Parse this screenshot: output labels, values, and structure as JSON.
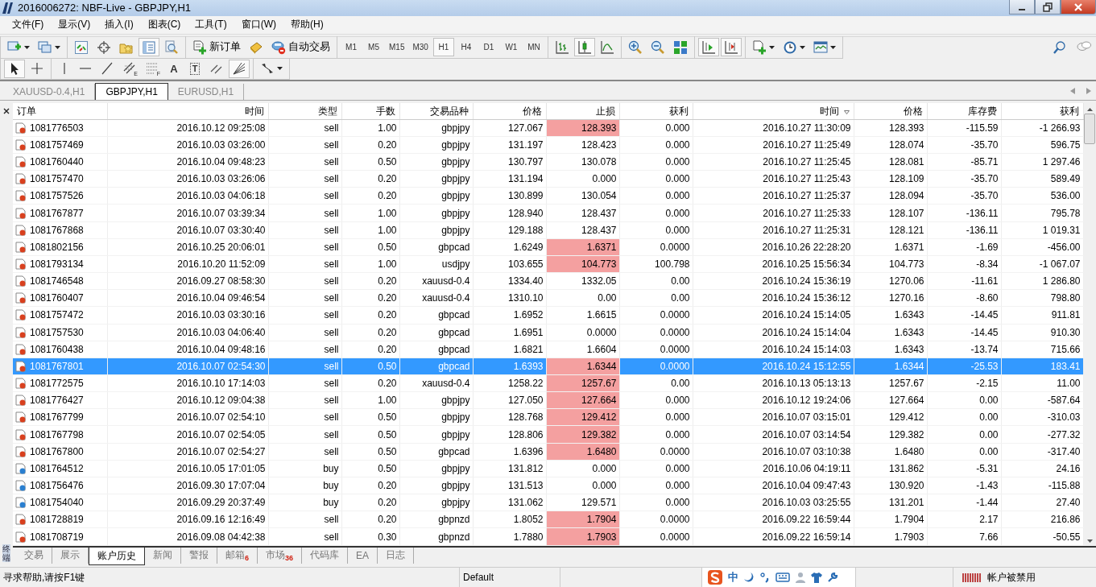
{
  "window": {
    "title": "2016006272: NBF-Live - GBPJPY,H1"
  },
  "menu": [
    {
      "label": "文件(F)"
    },
    {
      "label": "显示(V)"
    },
    {
      "label": "插入(I)"
    },
    {
      "label": "图表(C)"
    },
    {
      "label": "工具(T)"
    },
    {
      "label": "窗口(W)"
    },
    {
      "label": "帮助(H)"
    }
  ],
  "toolbar_main": {
    "groups": [
      {
        "items": [
          {
            "kind": "new-chart",
            "pressed": false,
            "dropdown": true
          },
          {
            "kind": "profiles",
            "pressed": false,
            "dropdown": true
          }
        ]
      },
      {
        "items": [
          {
            "kind": "market-watch",
            "pressed": false
          },
          {
            "kind": "data-window",
            "pressed": false
          },
          {
            "kind": "navigator",
            "pressed": false
          },
          {
            "kind": "terminal",
            "pressed": true
          },
          {
            "kind": "tester",
            "pressed": false
          }
        ]
      },
      {
        "items": [
          {
            "kind": "new-order",
            "label": "新订单",
            "pressed": false
          },
          {
            "kind": "editor",
            "pressed": false
          },
          {
            "kind": "auto-trading",
            "label": "自动交易",
            "pressed": false
          }
        ]
      },
      {
        "items": [
          {
            "kind": "timeframe",
            "label": "M1",
            "selected": false
          },
          {
            "kind": "timeframe",
            "label": "M5",
            "selected": false
          },
          {
            "kind": "timeframe",
            "label": "M15",
            "selected": false
          },
          {
            "kind": "timeframe",
            "label": "M30",
            "selected": false
          },
          {
            "kind": "timeframe",
            "label": "H1",
            "selected": true
          },
          {
            "kind": "timeframe",
            "label": "H4",
            "selected": false
          },
          {
            "kind": "timeframe",
            "label": "D1",
            "selected": false
          },
          {
            "kind": "timeframe",
            "label": "W1",
            "selected": false
          },
          {
            "kind": "timeframe",
            "label": "MN",
            "selected": false
          }
        ]
      },
      {
        "items": [
          {
            "kind": "bar-chart",
            "pressed": false
          },
          {
            "kind": "candle-chart",
            "pressed": true
          },
          {
            "kind": "line-chart",
            "pressed": false
          }
        ]
      },
      {
        "items": [
          {
            "kind": "zoom-in",
            "pressed": false
          },
          {
            "kind": "zoom-out",
            "pressed": false
          },
          {
            "kind": "tile",
            "pressed": false
          }
        ]
      },
      {
        "items": [
          {
            "kind": "autoscroll",
            "pressed": true
          },
          {
            "kind": "chart-shift",
            "pressed": true
          }
        ]
      },
      {
        "items": [
          {
            "kind": "indicators",
            "pressed": false,
            "dropdown": true
          },
          {
            "kind": "periods",
            "pressed": false,
            "dropdown": true
          },
          {
            "kind": "templates",
            "pressed": false,
            "dropdown": true
          }
        ]
      }
    ]
  },
  "toolbar_right": [
    {
      "kind": "search"
    },
    {
      "kind": "chat"
    }
  ],
  "toolbar_draw": {
    "groups": [
      {
        "items": [
          {
            "kind": "cursor",
            "pressed": true
          },
          {
            "kind": "crosshair",
            "pressed": false
          }
        ]
      },
      {
        "items": [
          {
            "kind": "vline",
            "pressed": false
          },
          {
            "kind": "hline",
            "pressed": false
          },
          {
            "kind": "trendline",
            "pressed": false
          },
          {
            "kind": "channel",
            "mark": "E",
            "pressed": false
          },
          {
            "kind": "fibo",
            "mark": "F",
            "pressed": false
          },
          {
            "kind": "text",
            "label": "A",
            "pressed": false
          },
          {
            "kind": "label",
            "label": "T",
            "pressed": false
          },
          {
            "kind": "parallel",
            "pressed": false
          },
          {
            "kind": "fan",
            "pressed": true
          }
        ]
      },
      {
        "items": [
          {
            "kind": "arrows",
            "pressed": false,
            "dropdown": true
          }
        ]
      }
    ]
  },
  "chart_tabs": [
    {
      "label": "XAUUSD-0.4,H1",
      "selected": false
    },
    {
      "label": "GBPJPY,H1",
      "selected": true
    },
    {
      "label": "EURUSD,H1",
      "selected": false
    }
  ],
  "terminal": {
    "side_label": "终端",
    "table": {
      "columns": [
        {
          "label": "订单",
          "sorted": false
        },
        {
          "label": "时间",
          "sorted": false
        },
        {
          "label": "类型",
          "sorted": false
        },
        {
          "label": "手数",
          "sorted": false
        },
        {
          "label": "交易品种",
          "sorted": false
        },
        {
          "label": "价格",
          "sorted": false
        },
        {
          "label": "止损",
          "sorted": false
        },
        {
          "label": "获利",
          "sorted": false
        },
        {
          "label": "时间",
          "sorted": true
        },
        {
          "label": "价格",
          "sorted": false
        },
        {
          "label": "库存费",
          "sorted": false
        },
        {
          "label": "获利",
          "sorted": false
        }
      ],
      "rows": [
        {
          "kind": "sell",
          "selected": false,
          "sl_hit": true,
          "cells": [
            "1081776503",
            "2016.10.12 09:25:08",
            "sell",
            "1.00",
            "gbpjpy",
            "127.067",
            "128.393",
            "0.000",
            "2016.10.27 11:30:09",
            "128.393",
            "-115.59",
            "-1 266.93"
          ]
        },
        {
          "kind": "sell",
          "selected": false,
          "sl_hit": false,
          "cells": [
            "1081757469",
            "2016.10.03 03:26:00",
            "sell",
            "0.20",
            "gbpjpy",
            "131.197",
            "128.423",
            "0.000",
            "2016.10.27 11:25:49",
            "128.074",
            "-35.70",
            "596.75"
          ]
        },
        {
          "kind": "sell",
          "selected": false,
          "sl_hit": false,
          "cells": [
            "1081760440",
            "2016.10.04 09:48:23",
            "sell",
            "0.50",
            "gbpjpy",
            "130.797",
            "130.078",
            "0.000",
            "2016.10.27 11:25:45",
            "128.081",
            "-85.71",
            "1 297.46"
          ]
        },
        {
          "kind": "sell",
          "selected": false,
          "sl_hit": false,
          "cells": [
            "1081757470",
            "2016.10.03 03:26:06",
            "sell",
            "0.20",
            "gbpjpy",
            "131.194",
            "0.000",
            "0.000",
            "2016.10.27 11:25:43",
            "128.109",
            "-35.70",
            "589.49"
          ]
        },
        {
          "kind": "sell",
          "selected": false,
          "sl_hit": false,
          "cells": [
            "1081757526",
            "2016.10.03 04:06:18",
            "sell",
            "0.20",
            "gbpjpy",
            "130.899",
            "130.054",
            "0.000",
            "2016.10.27 11:25:37",
            "128.094",
            "-35.70",
            "536.00"
          ]
        },
        {
          "kind": "sell",
          "selected": false,
          "sl_hit": false,
          "cells": [
            "1081767877",
            "2016.10.07 03:39:34",
            "sell",
            "1.00",
            "gbpjpy",
            "128.940",
            "128.437",
            "0.000",
            "2016.10.27 11:25:33",
            "128.107",
            "-136.11",
            "795.78"
          ]
        },
        {
          "kind": "sell",
          "selected": false,
          "sl_hit": false,
          "cells": [
            "1081767868",
            "2016.10.07 03:30:40",
            "sell",
            "1.00",
            "gbpjpy",
            "129.188",
            "128.437",
            "0.000",
            "2016.10.27 11:25:31",
            "128.121",
            "-136.11",
            "1 019.31"
          ]
        },
        {
          "kind": "sell",
          "selected": false,
          "sl_hit": true,
          "cells": [
            "1081802156",
            "2016.10.25 20:06:01",
            "sell",
            "0.50",
            "gbpcad",
            "1.6249",
            "1.6371",
            "0.0000",
            "2016.10.26 22:28:20",
            "1.6371",
            "-1.69",
            "-456.00"
          ]
        },
        {
          "kind": "sell",
          "selected": false,
          "sl_hit": true,
          "cells": [
            "1081793134",
            "2016.10.20 11:52:09",
            "sell",
            "1.00",
            "usdjpy",
            "103.655",
            "104.773",
            "100.798",
            "2016.10.25 15:56:34",
            "104.773",
            "-8.34",
            "-1 067.07"
          ]
        },
        {
          "kind": "sell",
          "selected": false,
          "sl_hit": false,
          "cells": [
            "1081746548",
            "2016.09.27 08:58:30",
            "sell",
            "0.20",
            "xauusd-0.4",
            "1334.40",
            "1332.05",
            "0.00",
            "2016.10.24 15:36:19",
            "1270.06",
            "-11.61",
            "1 286.80"
          ]
        },
        {
          "kind": "sell",
          "selected": false,
          "sl_hit": false,
          "cells": [
            "1081760407",
            "2016.10.04 09:46:54",
            "sell",
            "0.20",
            "xauusd-0.4",
            "1310.10",
            "0.00",
            "0.00",
            "2016.10.24 15:36:12",
            "1270.16",
            "-8.60",
            "798.80"
          ]
        },
        {
          "kind": "sell",
          "selected": false,
          "sl_hit": false,
          "cells": [
            "1081757472",
            "2016.10.03 03:30:16",
            "sell",
            "0.20",
            "gbpcad",
            "1.6952",
            "1.6615",
            "0.0000",
            "2016.10.24 15:14:05",
            "1.6343",
            "-14.45",
            "911.81"
          ]
        },
        {
          "kind": "sell",
          "selected": false,
          "sl_hit": false,
          "cells": [
            "1081757530",
            "2016.10.03 04:06:40",
            "sell",
            "0.20",
            "gbpcad",
            "1.6951",
            "0.0000",
            "0.0000",
            "2016.10.24 15:14:04",
            "1.6343",
            "-14.45",
            "910.30"
          ]
        },
        {
          "kind": "sell",
          "selected": false,
          "sl_hit": false,
          "cells": [
            "1081760438",
            "2016.10.04 09:48:16",
            "sell",
            "0.20",
            "gbpcad",
            "1.6821",
            "1.6604",
            "0.0000",
            "2016.10.24 15:14:03",
            "1.6343",
            "-13.74",
            "715.66"
          ]
        },
        {
          "kind": "sell",
          "selected": true,
          "sl_hit": true,
          "cells": [
            "1081767801",
            "2016.10.07 02:54:30",
            "sell",
            "0.50",
            "gbpcad",
            "1.6393",
            "1.6344",
            "0.0000",
            "2016.10.24 15:12:55",
            "1.6344",
            "-25.53",
            "183.41"
          ]
        },
        {
          "kind": "sell",
          "selected": false,
          "sl_hit": true,
          "cells": [
            "1081772575",
            "2016.10.10 17:14:03",
            "sell",
            "0.20",
            "xauusd-0.4",
            "1258.22",
            "1257.67",
            "0.00",
            "2016.10.13 05:13:13",
            "1257.67",
            "-2.15",
            "11.00"
          ]
        },
        {
          "kind": "sell",
          "selected": false,
          "sl_hit": true,
          "cells": [
            "1081776427",
            "2016.10.12 09:04:38",
            "sell",
            "1.00",
            "gbpjpy",
            "127.050",
            "127.664",
            "0.000",
            "2016.10.12 19:24:06",
            "127.664",
            "0.00",
            "-587.64"
          ]
        },
        {
          "kind": "sell",
          "selected": false,
          "sl_hit": true,
          "cells": [
            "1081767799",
            "2016.10.07 02:54:10",
            "sell",
            "0.50",
            "gbpjpy",
            "128.768",
            "129.412",
            "0.000",
            "2016.10.07 03:15:01",
            "129.412",
            "0.00",
            "-310.03"
          ]
        },
        {
          "kind": "sell",
          "selected": false,
          "sl_hit": true,
          "cells": [
            "1081767798",
            "2016.10.07 02:54:05",
            "sell",
            "0.50",
            "gbpjpy",
            "128.806",
            "129.382",
            "0.000",
            "2016.10.07 03:14:54",
            "129.382",
            "0.00",
            "-277.32"
          ]
        },
        {
          "kind": "sell",
          "selected": false,
          "sl_hit": true,
          "cells": [
            "1081767800",
            "2016.10.07 02:54:27",
            "sell",
            "0.50",
            "gbpcad",
            "1.6396",
            "1.6480",
            "0.0000",
            "2016.10.07 03:10:38",
            "1.6480",
            "0.00",
            "-317.40"
          ]
        },
        {
          "kind": "buy",
          "selected": false,
          "sl_hit": false,
          "cells": [
            "1081764512",
            "2016.10.05 17:01:05",
            "buy",
            "0.50",
            "gbpjpy",
            "131.812",
            "0.000",
            "0.000",
            "2016.10.06 04:19:11",
            "131.862",
            "-5.31",
            "24.16"
          ]
        },
        {
          "kind": "buy",
          "selected": false,
          "sl_hit": false,
          "cells": [
            "1081756476",
            "2016.09.30 17:07:04",
            "buy",
            "0.20",
            "gbpjpy",
            "131.513",
            "0.000",
            "0.000",
            "2016.10.04 09:47:43",
            "130.920",
            "-1.43",
            "-115.88"
          ]
        },
        {
          "kind": "buy",
          "selected": false,
          "sl_hit": false,
          "cells": [
            "1081754040",
            "2016.09.29 20:37:49",
            "buy",
            "0.20",
            "gbpjpy",
            "131.062",
            "129.571",
            "0.000",
            "2016.10.03 03:25:55",
            "131.201",
            "-1.44",
            "27.40"
          ]
        },
        {
          "kind": "sell",
          "selected": false,
          "sl_hit": true,
          "cells": [
            "1081728819",
            "2016.09.16 12:16:49",
            "sell",
            "0.20",
            "gbpnzd",
            "1.8052",
            "1.7904",
            "0.0000",
            "2016.09.22 16:59:44",
            "1.7904",
            "2.17",
            "216.86"
          ]
        },
        {
          "kind": "sell",
          "selected": false,
          "sl_hit": true,
          "cells": [
            "1081708719",
            "2016.09.08 04:42:38",
            "sell",
            "0.30",
            "gbpnzd",
            "1.7880",
            "1.7903",
            "0.0000",
            "2016.09.22 16:59:14",
            "1.7903",
            "7.66",
            "-50.55"
          ]
        }
      ]
    },
    "tabs": [
      {
        "label": "交易",
        "selected": false
      },
      {
        "label": "展示",
        "selected": false
      },
      {
        "label": "账户历史",
        "selected": true
      },
      {
        "label": "新闻",
        "selected": false
      },
      {
        "label": "警报",
        "selected": false
      },
      {
        "label": "邮箱",
        "badge": "6",
        "selected": false
      },
      {
        "label": "市场",
        "badge": "36",
        "selected": false
      },
      {
        "label": "代码库",
        "selected": false
      },
      {
        "label": "EA",
        "selected": false
      },
      {
        "label": "日志",
        "selected": false
      }
    ]
  },
  "status_bar": {
    "help": "寻求帮助,请按F1键",
    "profile": "Default",
    "ime": {
      "label": "中"
    },
    "connection": "帐户被禁用"
  }
}
